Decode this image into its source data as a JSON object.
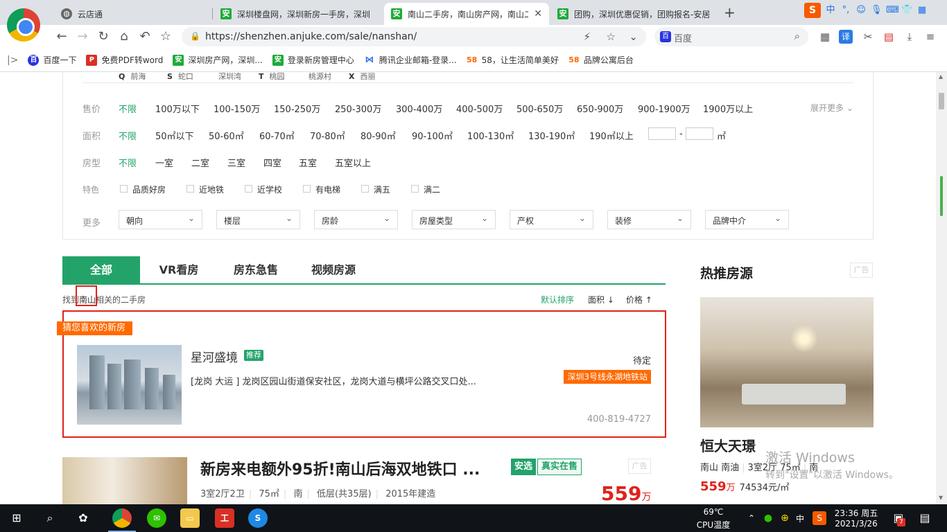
{
  "browser": {
    "tabs": [
      {
        "title": "云店通",
        "favicon": "globe-icon"
      },
      {
        "title": "深圳楼盘网，深圳新房一手房，深圳",
        "favicon": "anjuke-icon"
      },
      {
        "title": "南山二手房，南山房产网，南山二",
        "favicon": "anjuke-icon",
        "active": true
      },
      {
        "title": "团购，深圳优惠促销，团购报名-安居",
        "favicon": "anjuke-icon"
      }
    ],
    "new_tab": "+",
    "url": "https://shenzhen.anjuke.com/sale/nanshan/",
    "search_placeholder": "百度",
    "sogou": {
      "logo": "S",
      "ime": "中"
    },
    "bookmarks": [
      {
        "label": "百度一下",
        "icon": "baidu"
      },
      {
        "label": "免费PDF转word",
        "icon": "pdf"
      },
      {
        "label": "深圳房产网，深圳...",
        "icon": "ajk"
      },
      {
        "label": "登录新房管理中心",
        "icon": "ajk"
      },
      {
        "label": "腾讯企业邮箱-登录...",
        "icon": "tx"
      },
      {
        "label": "58，让生活简单美好",
        "icon": "w58"
      },
      {
        "label": "品牌公寓后台",
        "icon": "w58"
      }
    ],
    "icon_glyphs": {
      "ajk": "安",
      "baidu": "百",
      "pdf": "P",
      "tx": "⋈",
      "w58": "58"
    }
  },
  "filters": {
    "regions": [
      {
        "letter": "Q",
        "name": "前海"
      },
      {
        "letter": "S",
        "name": "蛇口"
      },
      {
        "letter": "",
        "name": "深圳湾"
      },
      {
        "letter": "T",
        "name": "桃园"
      },
      {
        "letter": "",
        "name": "桃源村"
      },
      {
        "letter": "X",
        "name": "西丽"
      }
    ],
    "price": {
      "label": "售价",
      "options": [
        "不限",
        "100万以下",
        "100-150万",
        "150-250万",
        "250-300万",
        "300-400万",
        "400-500万",
        "500-650万",
        "650-900万",
        "900-1900万",
        "1900万以上"
      ],
      "expand": "展开更多 ⌄"
    },
    "area": {
      "label": "面积",
      "options": [
        "不限",
        "50㎡以下",
        "50-60㎡",
        "60-70㎡",
        "70-80㎡",
        "80-90㎡",
        "90-100㎡",
        "100-130㎡",
        "130-190㎡",
        "190㎡以上"
      ],
      "range_sep": "-",
      "unit": "㎡"
    },
    "rooms": {
      "label": "房型",
      "options": [
        "不限",
        "一室",
        "二室",
        "三室",
        "四室",
        "五室",
        "五室以上"
      ]
    },
    "features": {
      "label": "特色",
      "options": [
        "品质好房",
        "近地铁",
        "近学校",
        "有电梯",
        "满五",
        "满二"
      ]
    },
    "more": {
      "label": "更多",
      "dropdowns": [
        "朝向",
        "楼层",
        "房龄",
        "房屋类型",
        "产权",
        "装修",
        "品牌中介"
      ]
    }
  },
  "list_tabs": [
    "全部",
    "VR看房",
    "房东急售",
    "视频房源"
  ],
  "result": {
    "prefix": "找到",
    "keyword": "南山",
    "suffix": "相关的二手房"
  },
  "sort": {
    "default": "默认排序",
    "area": "面积 ↓",
    "price": "价格 ↑"
  },
  "recommend": {
    "ribbon": "猜您喜欢的新房",
    "title": "星河盛境",
    "badge": "推荐",
    "address": "[龙岗 大运 ] 龙岗区园山街道保安社区，龙岗大道与横坪公路交叉口处...",
    "status": "待定",
    "metro": "深圳3号线永湖地铁站",
    "phone": "400-819-4727"
  },
  "listing": {
    "title": "新房来电额外95折!南山后海双地铁口 ...",
    "tag_anxuan": "安选",
    "tag_real": "真实在售",
    "ad": "广告",
    "meta": [
      "3室2厅2卫",
      "75㎡",
      "南",
      "低层(共35层)",
      "2015年建造"
    ],
    "price": "559",
    "price_unit": "万"
  },
  "hot": {
    "title": "热推房源",
    "ad": "广告",
    "name": "恒大天璟",
    "district": "南山 南油",
    "layout": "3室2厅 75㎡",
    "orientation": "南",
    "price": "559",
    "price_unit": "万",
    "unit_price": "74534元/㎡"
  },
  "watermark": {
    "line1": "激活 Windows",
    "line2": "转到\"设置\"以激活 Windows。"
  },
  "taskbar": {
    "temp": "69℃",
    "temp_label": "CPU温度",
    "ime": "中",
    "time": "23:36 周五",
    "date": "2021/3/26",
    "notif_count": "7"
  },
  "colors": {
    "accent": "#23a36a",
    "highlight": "#e0221b",
    "orange": "#ff6a00"
  }
}
